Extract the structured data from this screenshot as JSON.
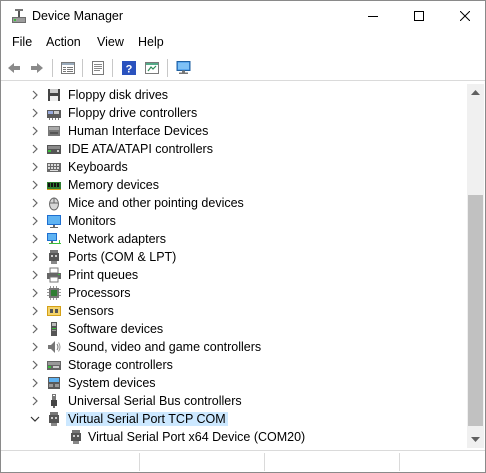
{
  "window": {
    "title": "Device Manager",
    "min_label": "Minimize",
    "max_label": "Maximize",
    "close_label": "Close"
  },
  "menu": {
    "items": [
      "File",
      "Action",
      "View",
      "Help"
    ]
  },
  "toolbar": {
    "buttons": [
      "back-icon",
      "forward-icon",
      "properties-icon",
      "update-driver-icon",
      "help-icon",
      "show-hidden-icon",
      "scan-hardware-icon"
    ]
  },
  "tree": {
    "categories": [
      {
        "label": "Floppy disk drives",
        "icon": "floppy-icon",
        "expanded": false
      },
      {
        "label": "Floppy drive controllers",
        "icon": "floppy-controller-icon",
        "expanded": false
      },
      {
        "label": "Human Interface Devices",
        "icon": "hid-icon",
        "expanded": false
      },
      {
        "label": "IDE ATA/ATAPI controllers",
        "icon": "ide-icon",
        "expanded": false
      },
      {
        "label": "Keyboards",
        "icon": "keyboard-icon",
        "expanded": false
      },
      {
        "label": "Memory devices",
        "icon": "memory-icon",
        "expanded": false
      },
      {
        "label": "Mice and other pointing devices",
        "icon": "mouse-icon",
        "expanded": false
      },
      {
        "label": "Monitors",
        "icon": "monitor-icon",
        "expanded": false
      },
      {
        "label": "Network adapters",
        "icon": "network-icon",
        "expanded": false
      },
      {
        "label": "Ports (COM & LPT)",
        "icon": "port-icon",
        "expanded": false
      },
      {
        "label": "Print queues",
        "icon": "printer-icon",
        "expanded": false
      },
      {
        "label": "Processors",
        "icon": "processor-icon",
        "expanded": false
      },
      {
        "label": "Sensors",
        "icon": "sensor-icon",
        "expanded": false
      },
      {
        "label": "Software devices",
        "icon": "software-device-icon",
        "expanded": false
      },
      {
        "label": "Sound, video and game controllers",
        "icon": "speaker-icon",
        "expanded": false
      },
      {
        "label": "Storage controllers",
        "icon": "storage-icon",
        "expanded": false
      },
      {
        "label": "System devices",
        "icon": "system-icon",
        "expanded": false
      },
      {
        "label": "Universal Serial Bus controllers",
        "icon": "usb-icon",
        "expanded": false
      },
      {
        "label": "Virtual Serial Port TCP COM",
        "icon": "serial-port-icon",
        "expanded": true,
        "selected": true
      }
    ],
    "children": [
      {
        "label": "Virtual Serial Port x64 Device (COM20)",
        "icon": "serial-port-icon"
      }
    ]
  },
  "scroll": {
    "position": 0.95,
    "visible_fraction": 0.7
  }
}
